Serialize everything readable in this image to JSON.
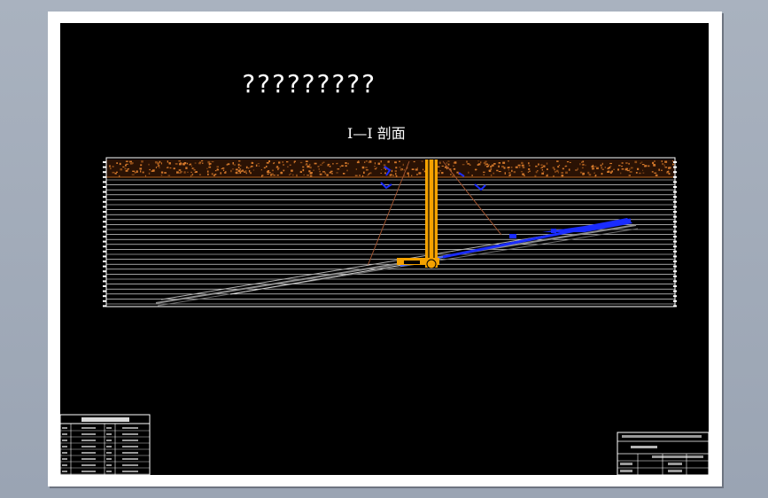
{
  "drawing": {
    "title": "?????????",
    "section_label": "I—I 剖面",
    "colors": {
      "background": "#000000",
      "strata_lines": "#ffffff",
      "soil_layer": "#b4621e",
      "shaft": "#f5a200",
      "roadway_blue": "#1a2cff",
      "seam_gray": "#8c8c8c",
      "slope_lines": "#a0522d"
    },
    "icons": [
      "shaft-icon",
      "surface-soil-layer"
    ]
  }
}
